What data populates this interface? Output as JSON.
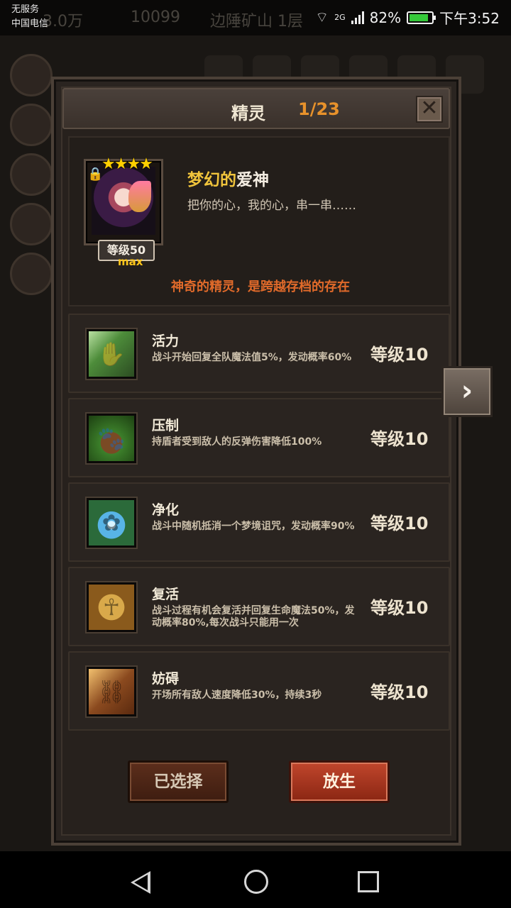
{
  "status_bar": {
    "carrier_line1": "无服务",
    "carrier_line2": "中国电信",
    "network": "2G",
    "battery": "82%",
    "time": "下午3:52"
  },
  "background_hud": {
    "coins": "3.0万",
    "gems": "10099",
    "location": "边陲矿山 1层"
  },
  "dialog": {
    "title": "精灵",
    "count": "1/23"
  },
  "spirit": {
    "stars": "★★★★",
    "name_prefix": "梦幻的",
    "name_main": "爱神",
    "description": "把你的心，我的心，串一串……",
    "level_label": "等级50",
    "max_label": "max",
    "note": "神奇的精灵，是跨越存档的存在"
  },
  "skills": [
    {
      "name": "活力",
      "desc": "战斗开始回复全队魔法值5%，发动概率60%",
      "level": "等级10",
      "icon": "vitality-icon"
    },
    {
      "name": "压制",
      "desc": "持盾者受到敌人的反弹伤害降低100%",
      "level": "等级10",
      "icon": "suppress-icon"
    },
    {
      "name": "净化",
      "desc": "战斗中随机抵消一个梦境诅咒，发动概率90%",
      "level": "等级10",
      "icon": "purify-icon"
    },
    {
      "name": "复活",
      "desc": "战斗过程有机会复活并回复生命魔法50%，发动概率80%,每次战斗只能用一次",
      "level": "等级10",
      "icon": "revive-icon"
    },
    {
      "name": "妨碍",
      "desc": "开场所有敌人速度降低30%，持续3秒",
      "level": "等级10",
      "icon": "hinder-icon"
    }
  ],
  "buttons": {
    "selected": "已选择",
    "release": "放生"
  },
  "colors": {
    "accent_orange": "#e8922b",
    "name_gold": "#f0c43c",
    "note_orange": "#e06a2a",
    "release_red": "#b0402a"
  }
}
